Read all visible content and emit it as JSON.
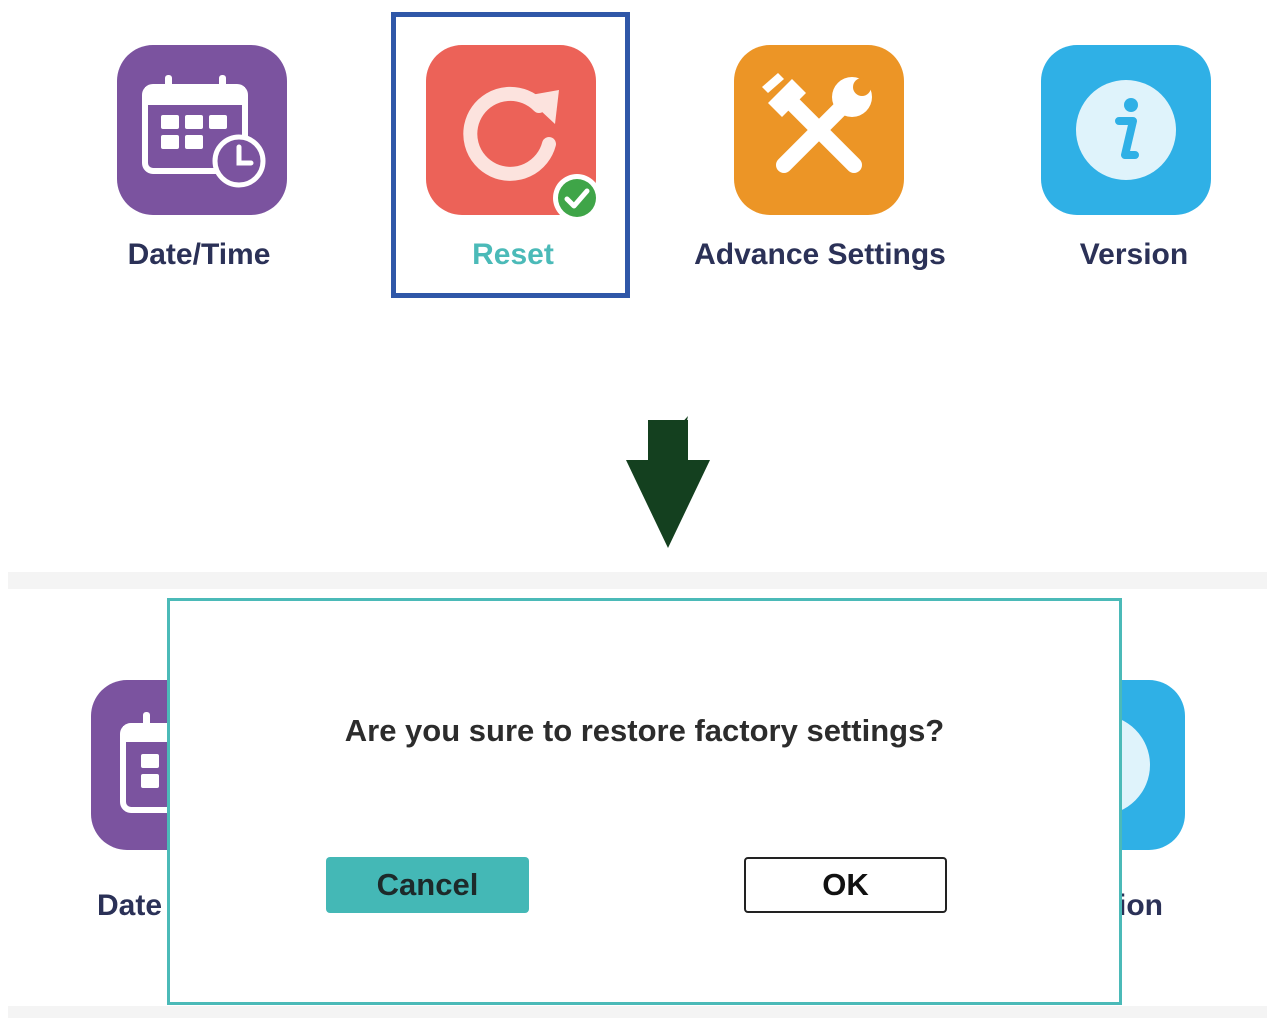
{
  "top_menu": {
    "items": [
      {
        "label": "Date/Time",
        "icon": "calendar-clock-icon",
        "color": "#7b539f"
      },
      {
        "label": "Reset",
        "icon": "reset-icon",
        "color": "#ec6258",
        "selected": true,
        "label_color": "#4bbab8"
      },
      {
        "label": "Advance Settings",
        "icon": "tools-icon",
        "color": "#ec9526"
      },
      {
        "label": "Version",
        "icon": "info-icon",
        "color": "#2fb0e6"
      }
    ]
  },
  "background_menu": {
    "left_label": "Date",
    "right_label": "ion"
  },
  "dialog": {
    "message": "Are you sure to restore factory settings?",
    "cancel_label": "Cancel",
    "ok_label": "OK"
  },
  "colors": {
    "accent": "#4bbab8",
    "selection": "#2f57a8",
    "arrow": "#14401f",
    "text": "#2b3157"
  }
}
